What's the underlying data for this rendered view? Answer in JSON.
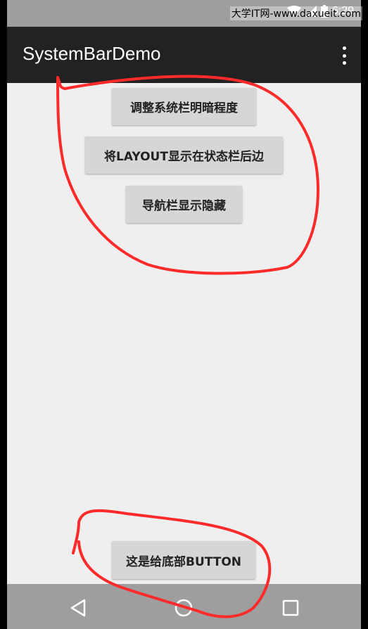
{
  "status_bar": {
    "time": "6:29",
    "icons": [
      "wifi-icon",
      "signal-icon",
      "battery-icon"
    ]
  },
  "watermark": "大学IT网-www.daxueit.com",
  "app_bar": {
    "title": "SystemBarDemo",
    "overflow_icon": "more-vert-icon"
  },
  "buttons": {
    "adjust_brightness": "调整系统栏明暗程度",
    "layout_behind_status": "将LAYOUT显示在状态栏后边",
    "toggle_nav": "导航栏显示隐藏",
    "bottom_button": "这是给底部BUTTON"
  },
  "nav_bar": {
    "back": "back-icon",
    "home": "home-icon",
    "recents": "recents-icon"
  },
  "colors": {
    "app_bar": "#222222",
    "system_bars": "#9e9e9e",
    "background": "#efefef",
    "button": "#d6d6d6",
    "annotation": "#ff2a2a"
  }
}
